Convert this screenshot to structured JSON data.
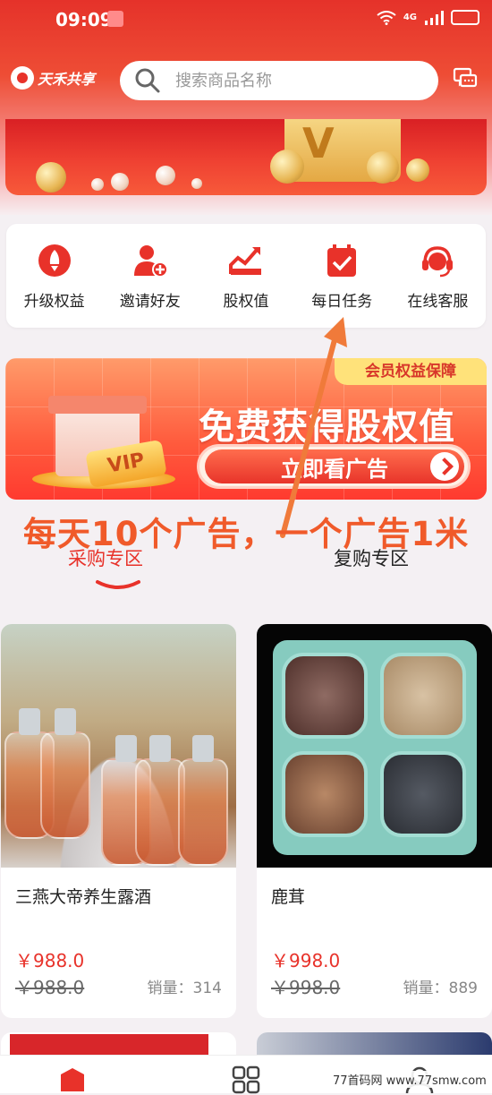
{
  "status_bar": {
    "time": "09:09",
    "network": "4G"
  },
  "header": {
    "logo_text": "天禾共享",
    "search_placeholder": "搜索商品名称"
  },
  "quick_actions": [
    {
      "label": "升级权益",
      "icon": "rocket-icon"
    },
    {
      "label": "邀请好友",
      "icon": "add-user-icon"
    },
    {
      "label": "股权值",
      "icon": "chart-icon"
    },
    {
      "label": "每日任务",
      "icon": "task-icon"
    },
    {
      "label": "在线客服",
      "icon": "headset-icon"
    }
  ],
  "promo": {
    "badge": "会员权益保障",
    "title": "免费获得股权值",
    "button": "立即看广告",
    "vip_tag": "VIP"
  },
  "annotation": "每天10个广告，一个广告1米",
  "tabs": [
    {
      "label": "采购专区",
      "active": true
    },
    {
      "label": "复购专区",
      "active": false
    }
  ],
  "products": [
    {
      "name": "三燕大帝养生露酒",
      "price": "￥988.0",
      "original_price": "￥988.0",
      "sales": "销量：314"
    },
    {
      "name": "鹿茸",
      "price": "￥998.0",
      "original_price": "￥998.0",
      "sales": "销量：889"
    }
  ],
  "bottom_nav": [
    {
      "icon": "home-icon",
      "active": true
    },
    {
      "icon": "category-icon",
      "active": false
    },
    {
      "icon": "user-icon",
      "active": false
    }
  ],
  "watermark": "77首码网 www.77smw.com",
  "colors": {
    "brand": "#e8322a",
    "annotation": "#f05a2a"
  }
}
